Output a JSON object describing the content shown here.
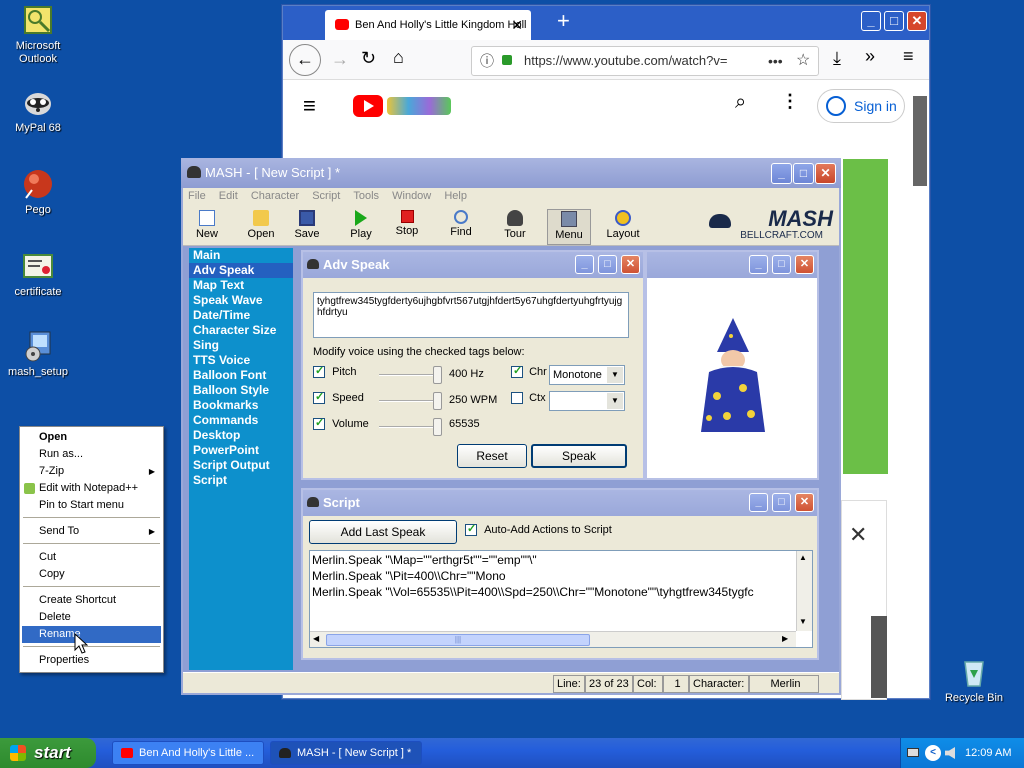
{
  "desktop": {
    "icons": [
      {
        "label": "Microsoft Outlook"
      },
      {
        "label": "MyPal 68"
      },
      {
        "label": "Pego"
      },
      {
        "label": "certificate"
      },
      {
        "label": "mash_setup"
      },
      {
        "label": "Recycle Bin"
      }
    ]
  },
  "browser": {
    "tab_title": "Ben And Holly's Little Kingdom Holl",
    "url": "https://www.youtube.com/watch?v=",
    "sign_in": "Sign in",
    "new_tab": "+",
    "close_popup": "✕"
  },
  "mash": {
    "title": "MASH - [ New Script ] *",
    "menu": [
      "File",
      "Edit",
      "Character",
      "Script",
      "Tools",
      "Window",
      "Help"
    ],
    "toolbar": [
      "New",
      "Open",
      "Save",
      "Play",
      "Stop",
      "Find",
      "Tour",
      "Menu",
      "Layout"
    ],
    "logo": "MASH",
    "logo_sub": "BELLCRAFT.COM",
    "nav": [
      "Main",
      "Adv Speak",
      "Map Text",
      "Speak Wave",
      "Date/Time",
      "Character Size",
      "Sing",
      "TTS Voice",
      "Balloon Font",
      "Balloon Style",
      "Bookmarks",
      "Commands",
      "Desktop",
      "PowerPoint",
      "Script Output",
      "Script"
    ],
    "nav_selected": "Adv Speak",
    "adv_speak": {
      "title": "Adv Speak",
      "text": "tyhgtfrew345tygfderty6ujhgbfvrt567utgjhfdert5y67uhgfdertyuhgfrtyujghfdrtyu",
      "modify_label": "Modify voice using the checked tags below:",
      "pitch_label": "Pitch",
      "pitch_value": "400 Hz",
      "speed_label": "Speed",
      "speed_value": "250 WPM",
      "volume_label": "Volume",
      "volume_value": "65535",
      "chr_label": "Chr",
      "chr_value": "Monotone",
      "ctx_label": "Ctx",
      "ctx_value": "",
      "reset": "Reset",
      "speak": "Speak"
    },
    "script": {
      "title": "Script",
      "add_last": "Add Last Speak",
      "auto_add": "Auto-Add Actions to Script",
      "lines": [
        "Merlin.Speak \"\\Map=\"\"erthgr5t\"\"=\"\"emp\"\"\\\"",
        "Merlin.Speak \"\\Pit=400\\\\Chr=\"\"Mono",
        "Merlin.Speak \"\\Vol=65535\\\\Pit=400\\\\Spd=250\\\\Chr=\"\"Monotone\"\"\\tyhgtfrew345tygfc"
      ],
      "scroll_grip": "|||"
    },
    "status": {
      "line_label": "Line:",
      "line_value": "23 of 23",
      "col_label": "Col:",
      "col_value": "1",
      "char_label": "Character:",
      "char_value": "Merlin"
    }
  },
  "context_menu": {
    "items": [
      "Open",
      "Run as...",
      "7-Zip",
      "Edit with Notepad++",
      "Pin to Start menu",
      "Send To",
      "Cut",
      "Copy",
      "Create Shortcut",
      "Delete",
      "Rename",
      "Properties"
    ],
    "highlighted": "Rename"
  },
  "taskbar": {
    "start": "start",
    "tasks": [
      "Ben And Holly's Little ...",
      "MASH - [ New Script ] *"
    ],
    "clock": "12:09 AM"
  },
  "colors": {
    "desktop": "#0d4fa6",
    "nav_bg": "#0d90cc",
    "highlight": "#316ac5"
  }
}
